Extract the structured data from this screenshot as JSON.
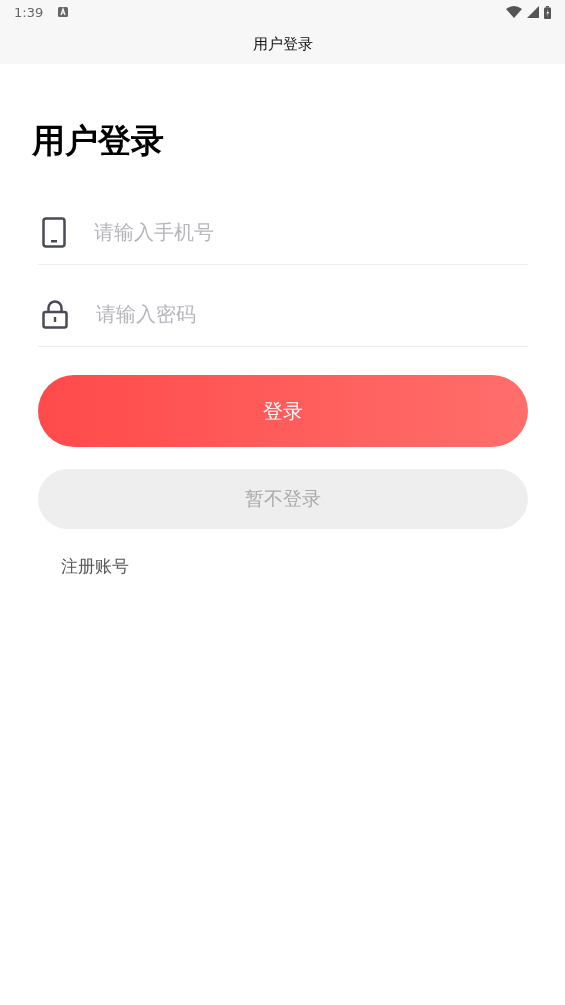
{
  "status_bar": {
    "time": "1:39"
  },
  "title_bar": {
    "title": "用户登录"
  },
  "heading": "用户登录",
  "fields": [
    {
      "kind": "phone",
      "placeholder": "请输入手机号"
    },
    {
      "kind": "password",
      "placeholder": "请输入密码"
    }
  ],
  "login_button": "登录",
  "skip_button": "暂不登录",
  "register_link": "注册账号"
}
